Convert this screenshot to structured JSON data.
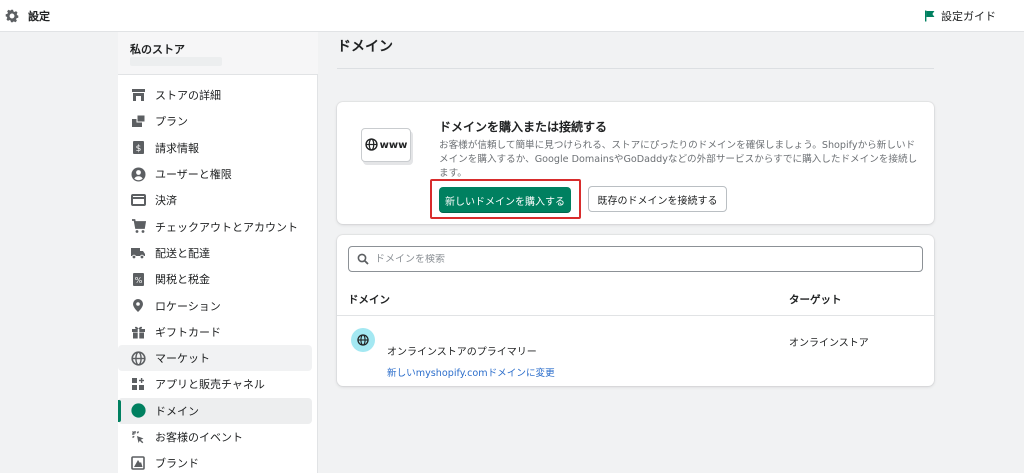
{
  "topbar": {
    "title": "設定",
    "guide_label": "設定ガイド"
  },
  "sidebar": {
    "store_name": "私のストア",
    "items": [
      {
        "label": "ストアの詳細",
        "icon": "store-icon"
      },
      {
        "label": "プラン",
        "icon": "plan-icon"
      },
      {
        "label": "請求情報",
        "icon": "billing-icon"
      },
      {
        "label": "ユーザーと権限",
        "icon": "user-icon"
      },
      {
        "label": "決済",
        "icon": "payment-icon"
      },
      {
        "label": "チェックアウトとアカウント",
        "icon": "checkout-icon"
      },
      {
        "label": "配送と配達",
        "icon": "truck-icon"
      },
      {
        "label": "関税と税金",
        "icon": "tax-icon"
      },
      {
        "label": "ロケーション",
        "icon": "location-icon"
      },
      {
        "label": "ギフトカード",
        "icon": "gift-icon"
      },
      {
        "label": "マーケット",
        "icon": "globe-icon"
      },
      {
        "label": "アプリと販売チャネル",
        "icon": "apps-icon"
      },
      {
        "label": "ドメイン",
        "icon": "globe-icon"
      },
      {
        "label": "お客様のイベント",
        "icon": "sparkle-icon"
      },
      {
        "label": "ブランド",
        "icon": "brand-icon"
      }
    ],
    "active_item": "ドメイン"
  },
  "main": {
    "title": "ドメイン",
    "connect_card": {
      "illustration_text": "www",
      "heading": "ドメインを購入または接続する",
      "description": "お客様が信頼して簡単に見つけられる、ストアにぴったりのドメインを確保しましょう。Shopifyから新しいドメインを購入するか、Google DomainsやGoDaddyなどの外部サービスからすでに購入したドメインを接続します。",
      "buy_button": "新しいドメインを購入する",
      "connect_button": "既存のドメインを接続する"
    },
    "domains_card": {
      "search_placeholder": "ドメインを検索",
      "columns": {
        "domain": "ドメイン",
        "target": "ターゲット"
      },
      "rows": [
        {
          "name": "オンラインストアのプライマリー",
          "link": "新しいmyshopify.comドメインに変更",
          "target": "オンラインストア"
        }
      ]
    }
  },
  "colors": {
    "accent": "#008060",
    "highlight": "#d82c2c",
    "link": "#2c6ecb",
    "globe_bg": "#a4e8f2"
  }
}
